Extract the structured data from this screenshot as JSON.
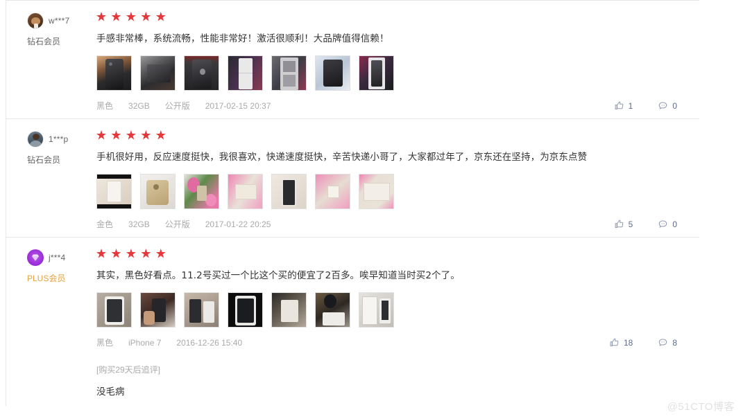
{
  "watermark": "@51CTO博客",
  "colors": {
    "star": "#e4393c",
    "plus_label": "#e6a23c",
    "action_text": "#5c6a8a",
    "meta_text": "#aaaaaa",
    "body_text": "#333333"
  },
  "reviews": [
    {
      "user": {
        "name": "w***7",
        "level": "钻石会员",
        "avatar_icon": "user-avatar-brown"
      },
      "rating": 5,
      "stars_icon": "star-icon",
      "text": "手感非常棒，系统流畅，性能非常好！激活很顺利！大品牌值得信赖！",
      "thumbnail_count": 7,
      "meta": {
        "color": "黑色",
        "capacity": "32GB",
        "version": "公开版",
        "date": "2017-02-15 20:37"
      },
      "actions": {
        "like_icon": "thumbs-up-icon",
        "like_count": "1",
        "comment_icon": "comment-bubble-icon",
        "comment_count": "0"
      },
      "append": null
    },
    {
      "user": {
        "name": "1***p",
        "level": "钻石会员",
        "avatar_icon": "user-avatar-photo"
      },
      "rating": 5,
      "stars_icon": "star-icon",
      "text": "手机很好用，反应速度挺快，我很喜欢，快递速度挺快，辛苦快递小哥了，大家都过年了，京东还在坚持，为京东点赞",
      "thumbnail_count": 7,
      "meta": {
        "color": "金色",
        "capacity": "32GB",
        "version": "公开版",
        "date": "2017-01-22 20:25"
      },
      "actions": {
        "like_icon": "thumbs-up-icon",
        "like_count": "5",
        "comment_icon": "comment-bubble-icon",
        "comment_count": "0"
      },
      "append": null
    },
    {
      "user": {
        "name": "j***4",
        "level": "PLUS会员",
        "avatar_icon": "plus-diamond-icon"
      },
      "rating": 5,
      "stars_icon": "star-icon",
      "text": "其实，黑色好看点。11.2号买过一个比这个买的便宜了2百多。唉早知道当时买2个了。",
      "thumbnail_count": 7,
      "meta": {
        "color": "黑色",
        "capacity": "iPhone 7",
        "version": "",
        "date": "2016-12-26 15:40"
      },
      "actions": {
        "like_icon": "thumbs-up-icon",
        "like_count": "18",
        "comment_icon": "comment-bubble-icon",
        "comment_count": "8"
      },
      "append": {
        "label": "[购买29天后追评]",
        "text": "没毛病"
      }
    }
  ]
}
